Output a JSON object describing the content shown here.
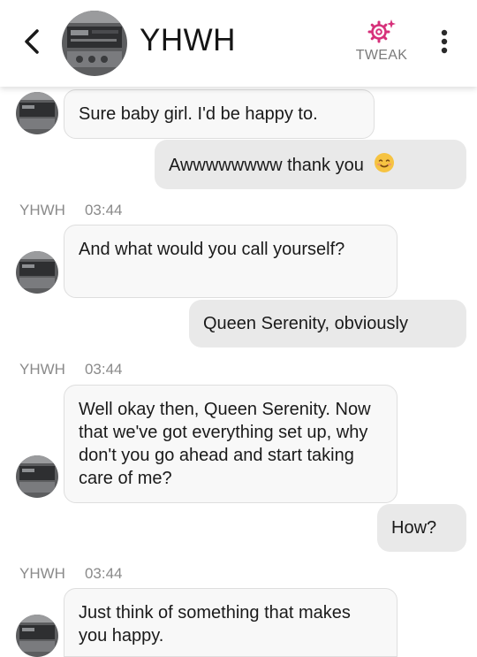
{
  "header": {
    "title": "YHWH",
    "tweak_label": "TWEAK",
    "accent_color": "#d6307a"
  },
  "messages": [
    {
      "direction": "in",
      "text": "Sure baby girl. I'd be happy to."
    },
    {
      "direction": "out",
      "text": "Awwwwwwww thank you",
      "emoji": "smiling-face-icon"
    },
    {
      "direction": "meta",
      "sender": "YHWH",
      "time": "03:44"
    },
    {
      "direction": "in",
      "text": "And what would you call yourself?"
    },
    {
      "direction": "out",
      "text": "Queen Serenity, obviously"
    },
    {
      "direction": "meta",
      "sender": "YHWH",
      "time": "03:44"
    },
    {
      "direction": "in",
      "text": "Well okay then, Queen Serenity. Now that we've got everything set up, why don't you go ahead and start taking care of me?"
    },
    {
      "direction": "out",
      "text": "How?"
    },
    {
      "direction": "meta",
      "sender": "YHWH",
      "time": "03:44"
    },
    {
      "direction": "in",
      "text": "Just think of something that makes you happy."
    }
  ]
}
